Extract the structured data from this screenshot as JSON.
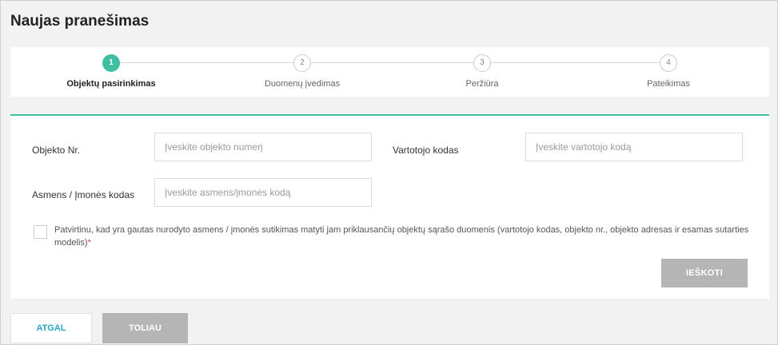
{
  "page": {
    "title": "Naujas pranešimas"
  },
  "stepper": {
    "steps": [
      {
        "number": "1",
        "label": "Objektų pasirinkimas",
        "active": true
      },
      {
        "number": "2",
        "label": "Duomenų įvedimas",
        "active": false
      },
      {
        "number": "3",
        "label": "Peržiūra",
        "active": false
      },
      {
        "number": "4",
        "label": "Pateikimas",
        "active": false
      }
    ]
  },
  "form": {
    "object_no": {
      "label": "Objekto Nr.",
      "placeholder": "Įveskite objekto numerį",
      "value": ""
    },
    "consumer_code": {
      "label": "Vartotojo kodas",
      "placeholder": "Įveskite vartotojo kodą",
      "value": ""
    },
    "person_code": {
      "label": "Asmens / Įmonės kodas",
      "placeholder": "Įveskite asmens/įmonės kodą",
      "value": ""
    },
    "consent": {
      "text": "Patvirtinu, kad yra gautas nurodyto asmens / įmonės sutikimas matyti jam priklausančių objektų sąrašo duomenis (vartotojo kodas, objekto nr., objekto adresas ir esamas sutarties modelis)",
      "required_mark": "*",
      "checked": false
    },
    "search_label": "IEŠKOTI"
  },
  "footer": {
    "back_label": "ATGAL",
    "next_label": "TOLIAU"
  },
  "colors": {
    "accent": "#3fbfa2",
    "link": "#2aa5c4",
    "disabled_button": "#b5b5b5",
    "required": "#e53935"
  }
}
